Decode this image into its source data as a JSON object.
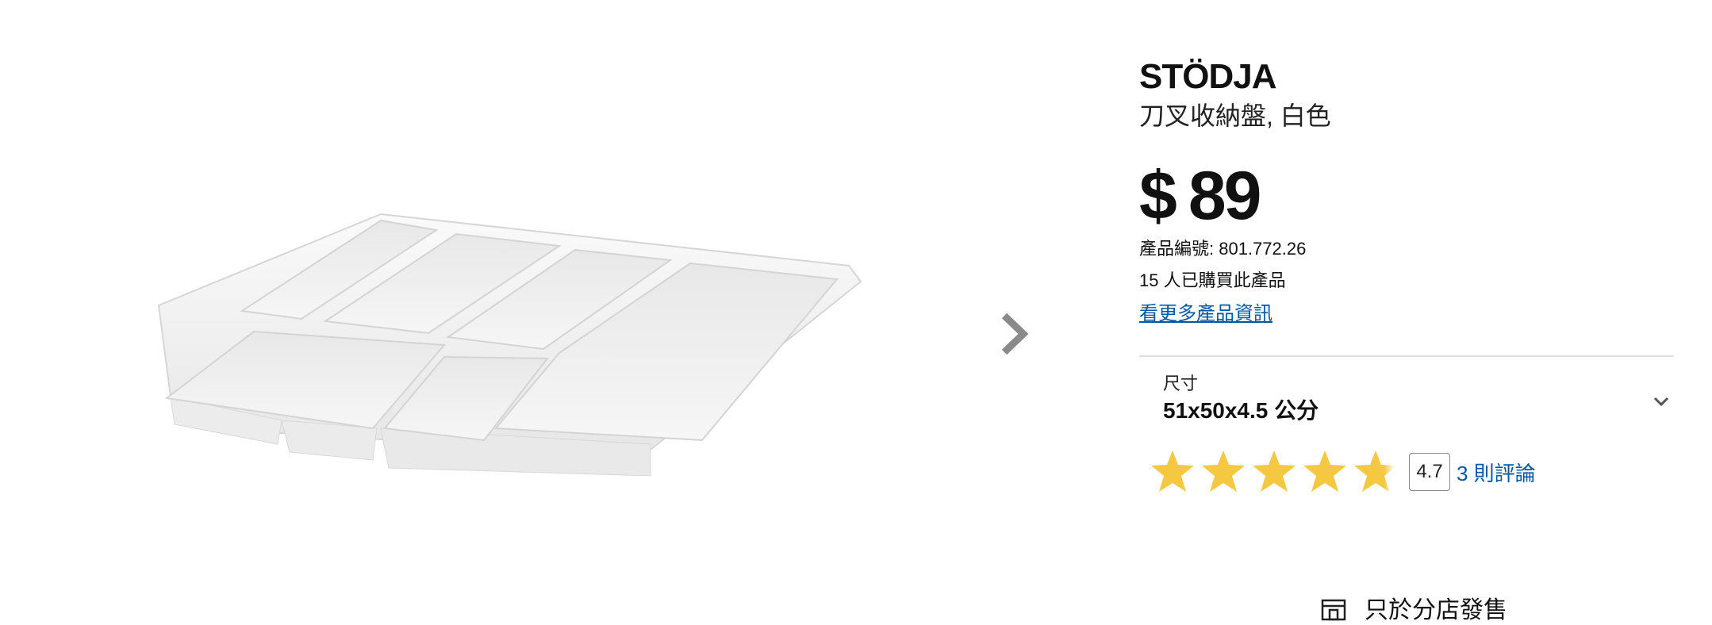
{
  "product": {
    "name": "STÖDJA",
    "subtitle": "刀叉收納盤, 白色",
    "price_currency": "$",
    "price_value": "89",
    "article_number": "產品編號: 801.772.26",
    "purchase_count": "15 人已購買此產品",
    "more_info_link": "看更多產品資訊"
  },
  "size": {
    "label": "尺寸",
    "value": "51x50x4.5 公分"
  },
  "rating": {
    "score": "4.7",
    "review_link": "3 則評論",
    "stars_fill": [
      1,
      1,
      1,
      1,
      0.7
    ],
    "star_color": "#f5c842"
  },
  "availability": {
    "store_only": "只於分店發售"
  },
  "colors": {
    "link": "#0058a3",
    "divider": "#dfdfdf"
  },
  "icons": {
    "next": "chevron-right-icon",
    "expand": "chevron-down-icon",
    "store": "store-icon"
  }
}
